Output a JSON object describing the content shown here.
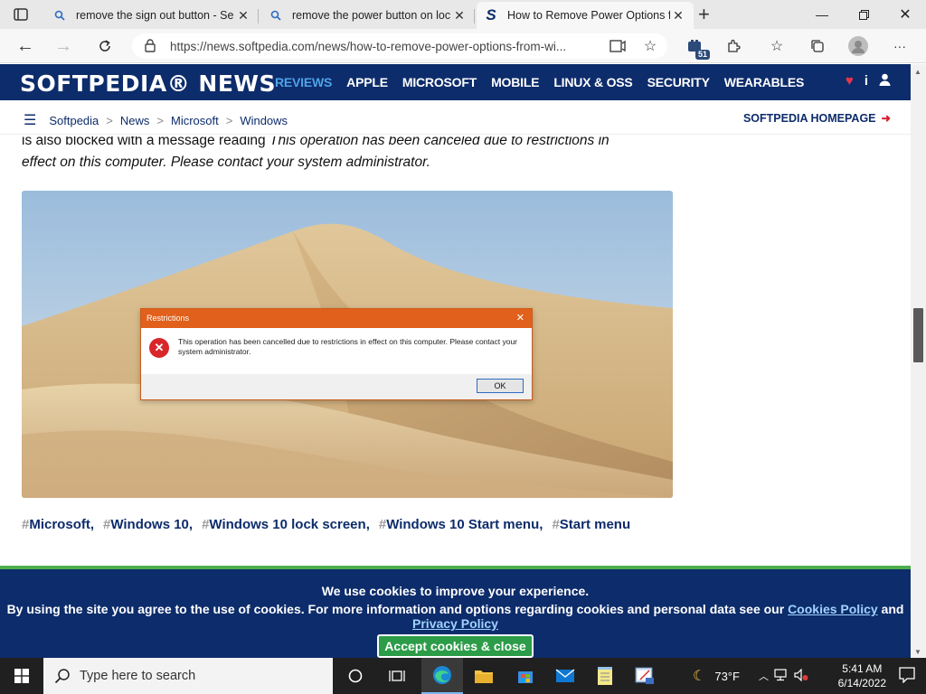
{
  "browser": {
    "tabs": [
      {
        "title": "remove the sign out button - Se",
        "icon": "search-icon",
        "active": false
      },
      {
        "title": "remove the power button on loc",
        "icon": "search-icon",
        "active": false
      },
      {
        "title": "How to Remove Power Options f",
        "icon": "softpedia-s-icon",
        "active": true
      }
    ],
    "url": "https://news.softpedia.com/news/how-to-remove-power-options-from-wi...",
    "extension_badge": "51"
  },
  "site": {
    "logo": "SOFTPEDIA® NEWS",
    "nav": [
      "REVIEWS",
      "APPLE",
      "MICROSOFT",
      "MOBILE",
      "LINUX & OSS",
      "SECURITY",
      "WEARABLES"
    ],
    "active_nav": "REVIEWS",
    "breadcrumbs": [
      "Softpedia",
      "News",
      "Microsoft",
      "Windows"
    ],
    "breadcrumb_sep": ">",
    "homepage_link": "SOFTPEDIA HOMEPAGE"
  },
  "article": {
    "lead_plain": "is also blocked with a message reading ",
    "lead_italic_1": "This operation has been canceled due to restrictions in",
    "lead_italic_2": "effect on this computer. Please contact your system administrator.",
    "dialog": {
      "title": "Restrictions",
      "message": "This operation has been cancelled due to restrictions in effect on this computer. Please contact your system administrator.",
      "ok": "OK"
    },
    "tags": [
      "Microsoft",
      "Windows 10",
      "Windows 10 lock screen",
      "Windows 10 Start menu",
      "Start menu"
    ]
  },
  "cookie": {
    "headline": "We use cookies to improve your experience.",
    "body": "By using the site you agree to the use of cookies. For more information and options regarding cookies and personal data see our ",
    "link1": "Cookies Policy",
    "and": " and ",
    "link2": "Privacy Policy",
    "accept": "Accept cookies & close"
  },
  "taskbar": {
    "search_placeholder": "Type here to search",
    "weather": "73°F",
    "time": "5:41 AM",
    "date": "6/14/2022"
  },
  "colors": {
    "header": "#0d2c6b",
    "nav_active": "#4ea3e8",
    "cookie_accent": "#4cae4c",
    "dialog_title": "#e0601c"
  }
}
